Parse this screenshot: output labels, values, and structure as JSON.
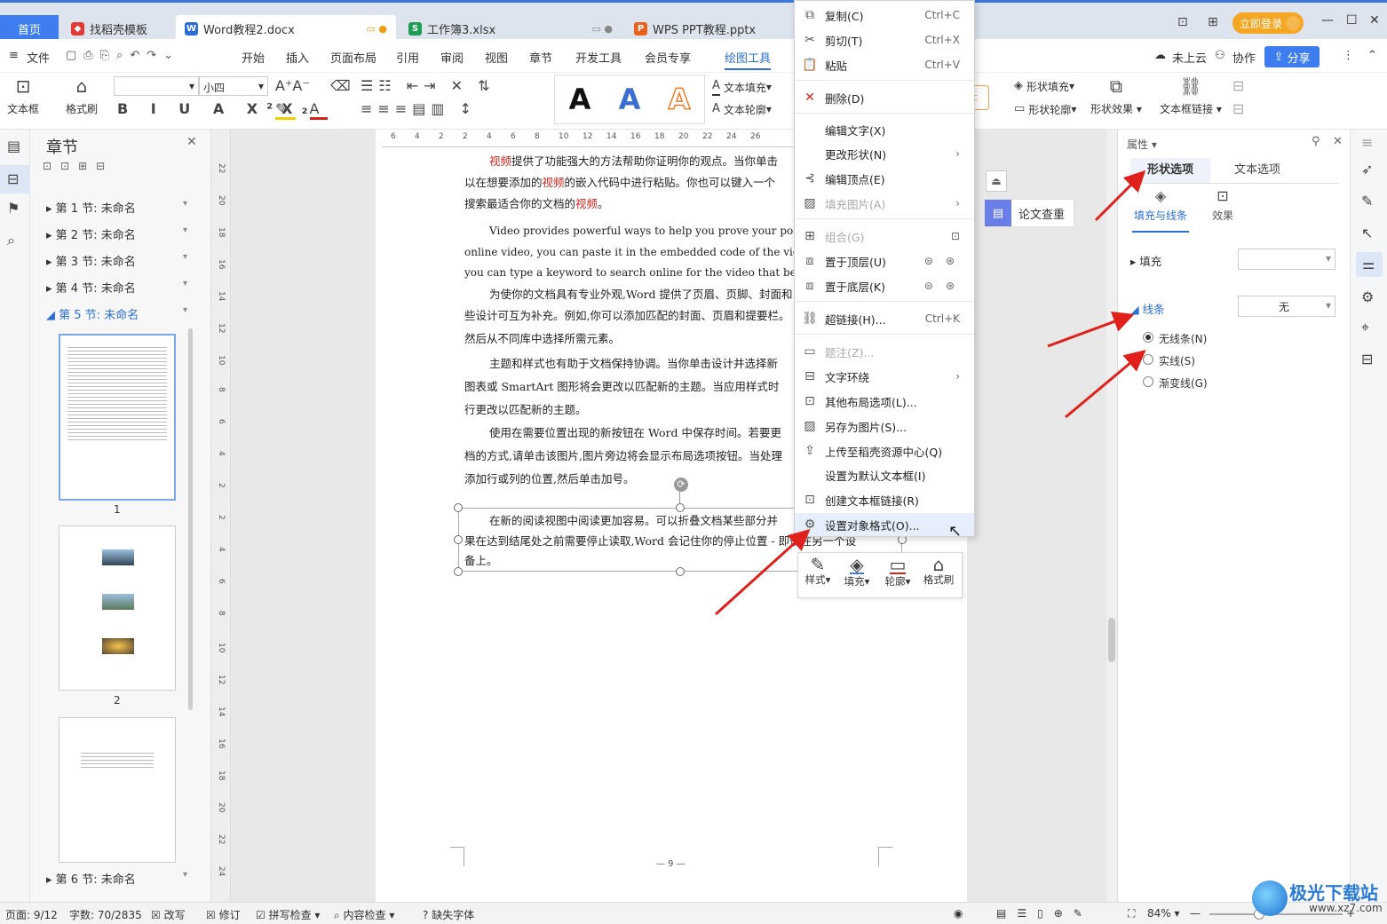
{
  "tabs": {
    "home": "首页",
    "t1": "找稻壳模板",
    "t2": "Word教程2.docx",
    "t3": "工作簿3.xlsx",
    "t4": "WPS PPT教程.pptx",
    "login": "立即登录"
  },
  "menu": {
    "file": "文件",
    "items": [
      "开始",
      "插入",
      "页面布局",
      "引用",
      "审阅",
      "视图",
      "章节",
      "开发工具",
      "会员专享",
      "绘图工具"
    ],
    "cloud": "未上云",
    "collab": "协作",
    "share": "分享"
  },
  "ribbon": {
    "textbox": "文本框",
    "format_painter": "格式刷",
    "font_size": "小四",
    "text_fill": "文本填充",
    "text_outline": "文本轮廓",
    "shape_fill": "形状填充",
    "shape_outline": "形状轮廓",
    "shape_effect": "形状效果",
    "textbox_link": "文本框链接",
    "style_letter": "A"
  },
  "nav": {
    "title": "章节",
    "sections": [
      "第 1 节: 未命名",
      "第 2 节: 未命名",
      "第 3 节: 未命名",
      "第 4 节: 未命名",
      "第 5 节: 未命名"
    ],
    "section6": "第 6 节: 未命名",
    "page1": "1",
    "page2": "2"
  },
  "ruler": [
    "6",
    "4",
    "2",
    "2",
    "4",
    "6",
    "8",
    "10",
    "12",
    "14",
    "16",
    "18",
    "20",
    "22",
    "24",
    "26"
  ],
  "vruler": [
    "22",
    "20",
    "18",
    "16",
    "14",
    "12",
    "10",
    "8",
    "6",
    "4",
    "2",
    "2",
    "4",
    "6",
    "8",
    "10",
    "12",
    "14",
    "16",
    "18",
    "20",
    "22",
    "24"
  ],
  "doc": {
    "p1a_pre": "提供了功能强大的方法帮助你证明你的观点。当你单击",
    "p1a_word": "视频",
    "p1b": "以在想要添加的",
    "p1b_word": "视频",
    "p1b_post": "的嵌入代码中进行粘贴。你也可以键入一个",
    "p1c": "搜索最适合你的文档的",
    "p1c_word": "视频",
    "p1c_post": "。",
    "p2a": "Video provides powerful ways to help you prove your point W",
    "p2b": "online video, you can paste it in the embedded code of the video yo",
    "p2c": "you can type a keyword to search online for the video that best suits y",
    "p3a": "为使你的文档具有专业外观,Word 提供了页眉、页脚、封面和",
    "p3b": "些设计可互为补充。例如,你可以添加匹配的封面、页眉和提要栏。",
    "p3c": "然后从不同库中选择所需元素。",
    "p4a": "主题和样式也有助于文档保持协调。当你单击设计并选择新",
    "p4b": "图表或 SmartArt 图形将会更改以匹配新的主题。当应用样式时",
    "p4c": "行更改以匹配新的主题。",
    "p5a": "使用在需要位置出现的新按钮在 Word 中保存时间。若要更",
    "p5b": "档的方式,请单击该图片,图片旁边将会显示布局选项按钮。当处理",
    "p5c": "添加行或列的位置,然后单击加号。",
    "p6a": "在新的阅读视图中阅读更加容易。可以折叠文档某些部分并",
    "p6b": "果在达到结尾处之前需要停止读取,Word 会记住你的停止位置 - 即使在另一个设",
    "p6c": "备上。",
    "page_num": "— 9 —"
  },
  "plagiarism": "论文查重",
  "context_menu": {
    "copy": "复制(C)",
    "copy_sc": "Ctrl+C",
    "cut": "剪切(T)",
    "cut_sc": "Ctrl+X",
    "paste": "粘贴",
    "paste_sc": "Ctrl+V",
    "delete": "删除(D)",
    "edit_text": "编辑文字(X)",
    "change_shape": "更改形状(N)",
    "edit_points": "编辑顶点(E)",
    "fill_picture": "填充图片(A)",
    "group": "组合(G)",
    "bring_front": "置于顶层(U)",
    "send_back": "置于底层(K)",
    "hyperlink": "超链接(H)...",
    "hyperlink_sc": "Ctrl+K",
    "caption": "题注(Z)...",
    "wrap": "文字环绕",
    "more_layout": "其他布局选项(L)...",
    "save_picture": "另存为图片(S)...",
    "upload": "上传至稻壳资源中心(Q)",
    "set_default": "设置为默认文本框(I)",
    "create_link": "创建文本框链接(R)",
    "format_object": "设置对象格式(O)..."
  },
  "mini_toolbar": [
    "样式",
    "填充",
    "轮廓",
    "格式刷"
  ],
  "props": {
    "title": "属性",
    "tab_shape": "形状选项",
    "tab_text": "文本选项",
    "sub_fill": "填充与线条",
    "sub_effect": "效果",
    "fill": "填充",
    "line": "线条",
    "line_value": "无",
    "no_line": "无线条(N)",
    "solid": "实线(S)",
    "gradient": "渐变线(G)"
  },
  "status": {
    "page": "页面: 9/12",
    "words": "字数: 70/2835",
    "overwrite": "改写",
    "revise": "修订",
    "spell": "拼写检查",
    "content": "内容检查",
    "missing_font": "缺失字体",
    "zoom": "84%"
  },
  "watermark": {
    "cn": "极光下载站",
    "url": "www.xz7.com"
  },
  "colors": {
    "accent": "#3d7df0",
    "arrow": "#e0201b",
    "login_bg": "#f5a623"
  }
}
